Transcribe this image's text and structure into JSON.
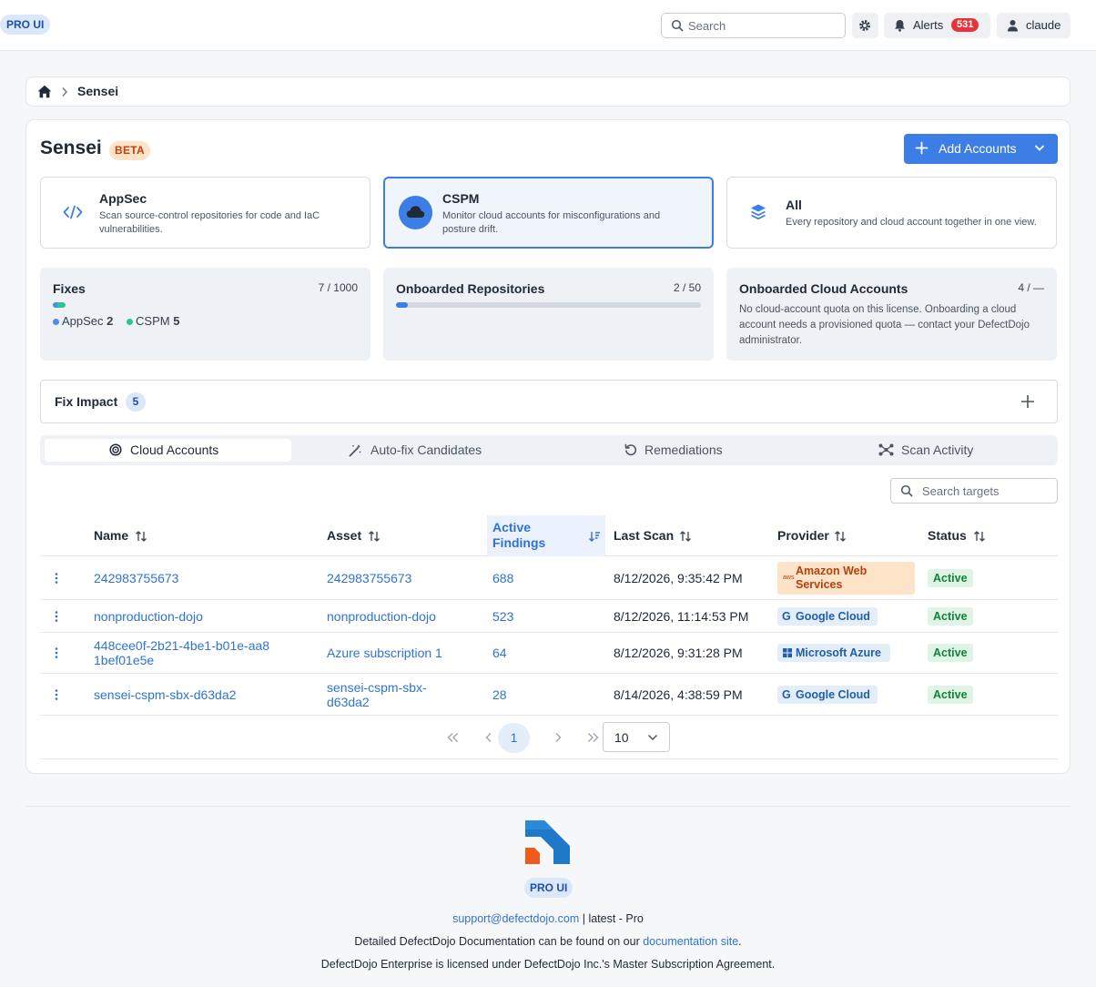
{
  "topbar": {
    "brand": "PRO UI",
    "search_placeholder": "Search",
    "alerts_label": "Alerts",
    "alerts_count": "531",
    "user_label": "claude"
  },
  "breadcrumb": {
    "current": "Sensei"
  },
  "header": {
    "title": "Sensei",
    "badge": "BETA",
    "add_button": "Add Accounts"
  },
  "modes": [
    {
      "title": "AppSec",
      "description": "Scan source-control repositories for code and IaC vulnerabilities.",
      "icon": "code-icon"
    },
    {
      "title": "CSPM",
      "description": "Monitor cloud accounts for misconfigurations and posture drift.",
      "icon": "cloud-icon",
      "selected": true
    },
    {
      "title": "All",
      "description": "Every repository and cloud account together in one view.",
      "icon": "layers-icon"
    }
  ],
  "stats": {
    "fixes": {
      "title": "Fixes",
      "ratio": "7 / 1000",
      "appsec_label": "AppSec",
      "appsec_value": "2",
      "cspm_label": "CSPM",
      "cspm_value": "5"
    },
    "repos": {
      "title": "Onboarded Repositories",
      "ratio": "2 / 50",
      "progress": 0.04
    },
    "cloud": {
      "title": "Onboarded Cloud Accounts",
      "ratio": "4 / —",
      "note": "No cloud-account quota on this license. Onboarding a cloud account needs a provisioned quota — contact your DefectDojo administrator."
    }
  },
  "fix_impact": {
    "label": "Fix Impact",
    "count": "5"
  },
  "tabs": [
    {
      "label": "Cloud Accounts",
      "icon": "target-icon",
      "active": true
    },
    {
      "label": "Auto-fix Candidates",
      "icon": "magic-wand-icon"
    },
    {
      "label": "Remediations",
      "icon": "undo-icon"
    },
    {
      "label": "Scan Activity",
      "icon": "network-icon"
    }
  ],
  "table": {
    "search_placeholder": "Search targets",
    "columns": {
      "name": "Name",
      "asset": "Asset",
      "findings": "Active Findings",
      "last_scan": "Last Scan",
      "provider": "Provider",
      "status": "Status"
    },
    "rows": [
      {
        "name": "242983755673",
        "asset": "242983755673",
        "findings": "688",
        "last_scan": "8/12/2026, 9:35:42 PM",
        "provider": "Amazon Web Services",
        "provider_mark": "aws",
        "status": "Active"
      },
      {
        "name": "nonproduction-dojo",
        "asset": "nonproduction-dojo",
        "findings": "523",
        "last_scan": "8/12/2026, 11:14:53 PM",
        "provider": "Google Cloud",
        "provider_mark": "G",
        "status": "Active"
      },
      {
        "name": "448cee0f-2b21-4be1-b01e-aa81bef01e5e",
        "asset": "Azure subscription 1",
        "findings": "64",
        "last_scan": "8/12/2026, 9:31:28 PM",
        "provider": "Microsoft Azure",
        "status": "Active"
      },
      {
        "name": "sensei-cspm-sbx-d63da2",
        "asset": "sensei-cspm-sbx-d63da2",
        "findings": "28",
        "last_scan": "8/14/2026, 4:38:59 PM",
        "provider": "Google Cloud",
        "provider_mark": "G",
        "status": "Active"
      }
    ]
  },
  "pagination": {
    "current_page": "1",
    "rows_per_page": "10"
  },
  "footer": {
    "brand": "PRO UI",
    "support_email": "support@defectdojo.com",
    "version": " | latest - Pro",
    "docs_prefix": "Detailed DefectDojo Documentation can be found on our ",
    "docs_link": "documentation site",
    "docs_suffix": ".",
    "license": "DefectDojo Enterprise is licensed under DefectDojo Inc.'s Master Subscription Agreement."
  },
  "colors": {
    "accent": "#3d7de6",
    "link": "#2f74d0",
    "aws": "#b4410c",
    "active": "#15803d",
    "alert": "#e5343c"
  }
}
